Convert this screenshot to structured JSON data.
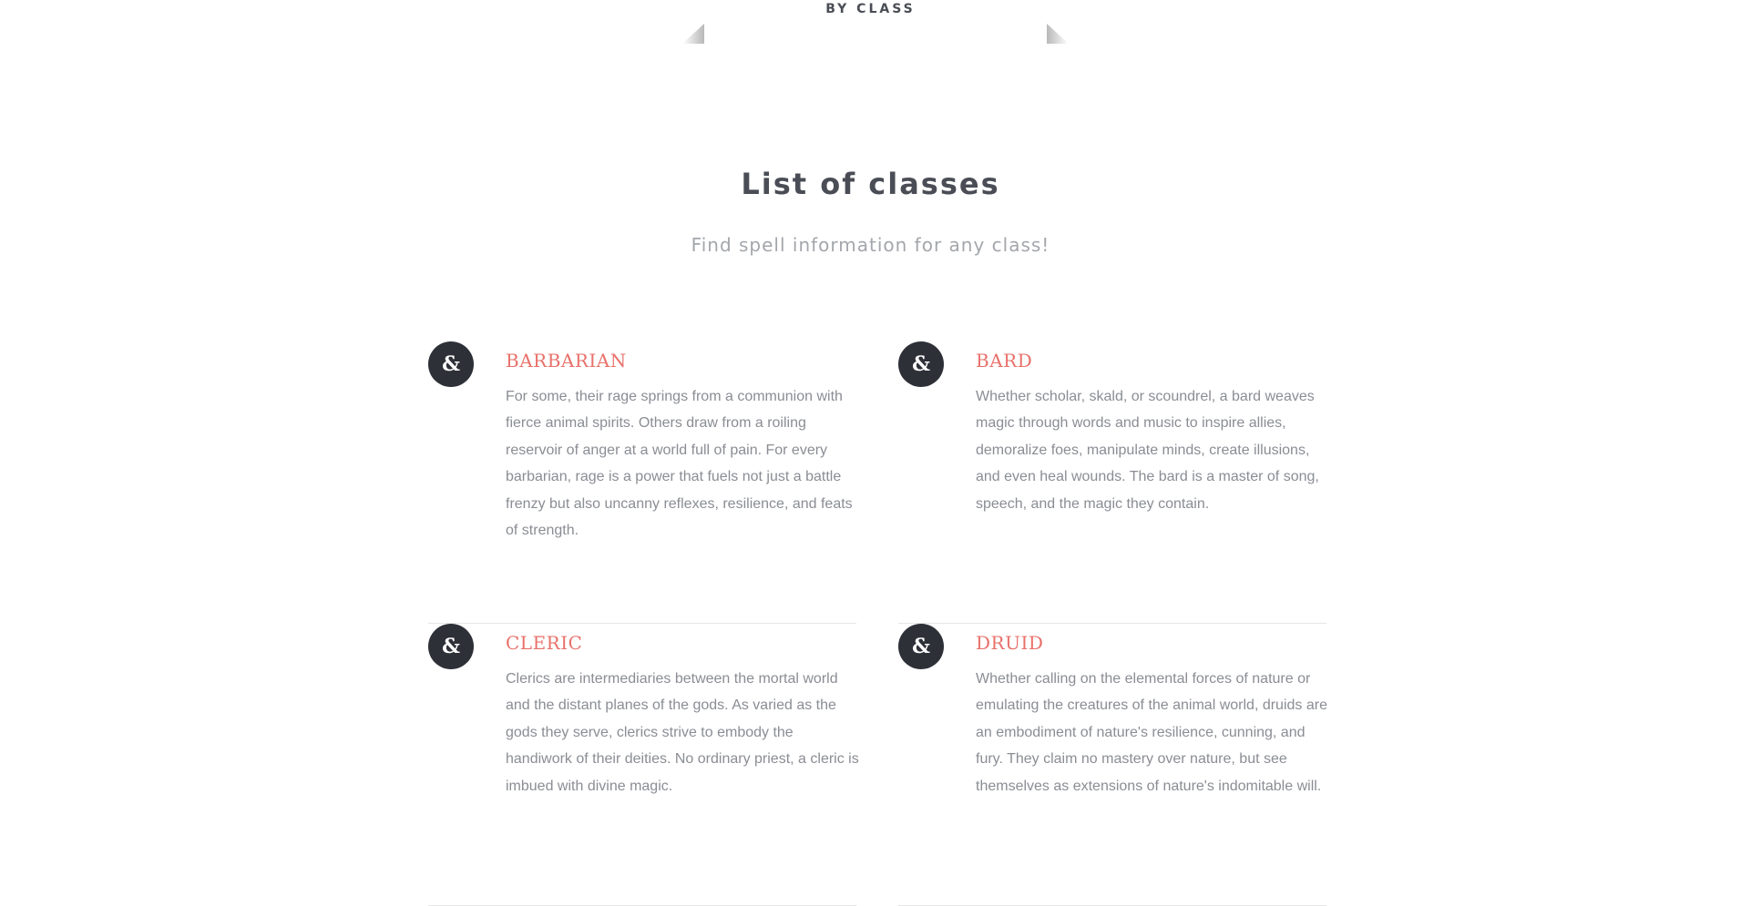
{
  "tab": {
    "label": "BY CLASS"
  },
  "section": {
    "title": "List of classes",
    "subtitle": "Find spell information for any class!"
  },
  "icon": {
    "name": "ampersand-icon",
    "glyph": "&"
  },
  "classes": [
    {
      "name": "BARBARIAN",
      "description": "For some, their rage springs from a communion with fierce animal spirits. Others draw from a roiling reservoir of anger at a world full of pain. For every barbarian, rage is a power that fuels not just a battle frenzy but also uncanny reflexes, resilience, and feats of strength."
    },
    {
      "name": "BARD",
      "description": "Whether scholar, skald, or scoundrel, a bard weaves magic through words and music to inspire allies, demoralize foes, manipulate minds, create illusions, and even heal wounds. The bard is a master of song, speech, and the magic they contain."
    },
    {
      "name": "CLERIC",
      "description": "Clerics are intermediaries between the mortal world and the distant planes of the gods. As varied as the gods they serve, clerics strive to embody the handiwork of their deities. No ordinary priest, a cleric is imbued with divine magic."
    },
    {
      "name": "DRUID",
      "description": "Whether calling on the elemental forces of nature or emulating the creatures of the animal world, druids are an embodiment of nature's resilience, cunning, and fury. They claim no mastery over nature, but see themselves as extensions of nature's indomitable will."
    }
  ],
  "colors": {
    "accent": "#e8716b",
    "heading": "#4a4d55",
    "muted": "#a3a6ab",
    "body_text": "#8a8d93",
    "avatar_bg": "#2e3038",
    "divider": "#e6e6e6"
  }
}
